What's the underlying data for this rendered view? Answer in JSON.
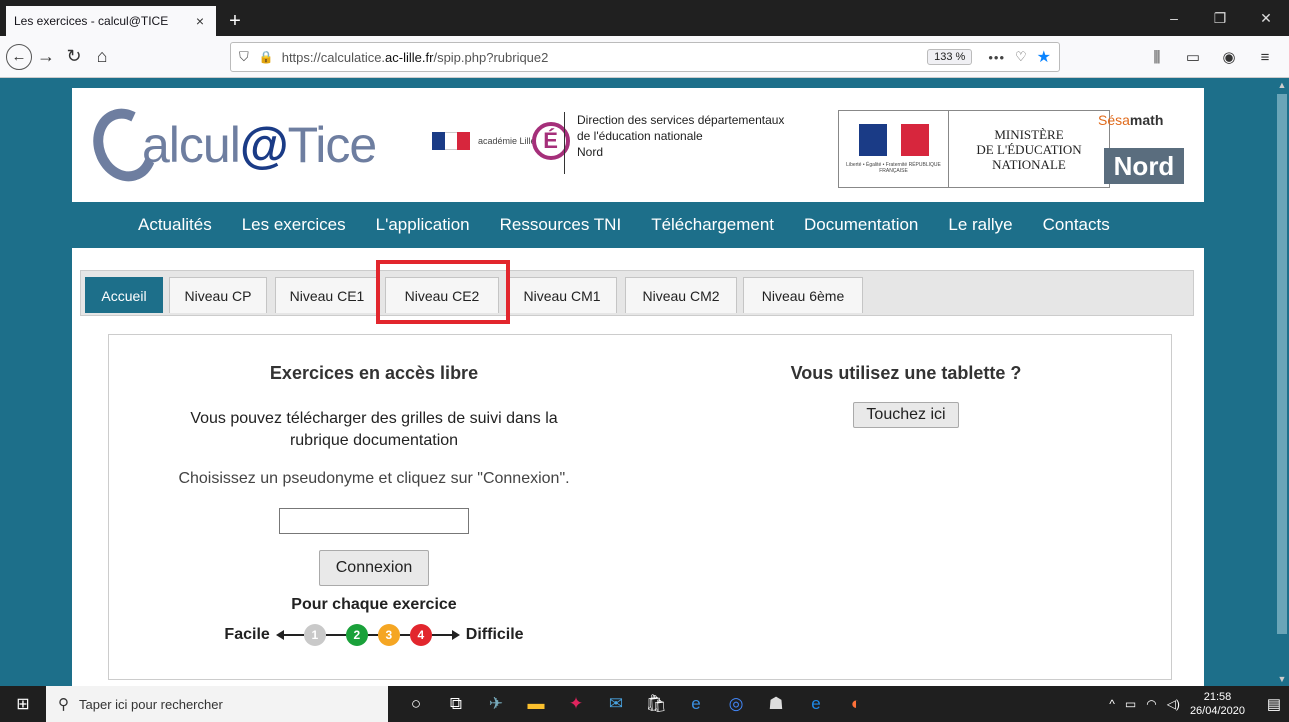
{
  "browser": {
    "tab_title": "Les exercices - calcul@TICE",
    "tab_close": "×",
    "new_tab": "+",
    "url_prefix": "https://calculatice.",
    "url_domain": "ac-lille.fr",
    "url_path": "/spip.php?rubrique2",
    "zoom": "133 %",
    "more": "•••",
    "window_min": "–",
    "window_max": "❐",
    "window_close": "✕"
  },
  "site": {
    "logo_text_1": "alcul",
    "logo_at": "@",
    "logo_text_2": "Tice",
    "academie_word": "académie Lille",
    "academie_letter": "É",
    "dsden_line1": "Direction des services départementaux",
    "dsden_line2": "de l'éducation nationale",
    "dsden_line3": "Nord",
    "ministere_motto": "Liberté • Égalité • Fraternité RÉPUBLIQUE FRANÇAISE",
    "ministere_line1": "MINISTÈRE",
    "ministere_line2": "DE L'ÉDUCATION",
    "ministere_line3": "NATIONALE",
    "sesamath_1": "Sésa",
    "sesamath_2": "math",
    "nord": "Nord"
  },
  "menu": [
    "Actualités",
    "Les exercices",
    "L'application",
    "Ressources TNI",
    "Téléchargement",
    "Documentation",
    "Le rallye",
    "Contacts"
  ],
  "tabs": [
    "Accueil",
    "Niveau CP",
    "Niveau CE1",
    "Niveau CE2",
    "Niveau CM1",
    "Niveau CM2",
    "Niveau 6ème"
  ],
  "left": {
    "heading": "Exercices en accès libre",
    "desc": "Vous pouvez télécharger des grilles de suivi dans la rubrique documentation",
    "pseudo_label": "Choisissez un pseudonyme et cliquez sur \"Connexion\".",
    "pseudo_value": "",
    "connexion": "Connexion",
    "pour": "Pour chaque exercice",
    "facile": "Facile",
    "difficile": "Difficile",
    "levels": [
      {
        "n": "1",
        "color": "#c9c9c9"
      },
      {
        "n": "2",
        "color": "#1aa13a"
      },
      {
        "n": "3",
        "color": "#f5a623"
      },
      {
        "n": "4",
        "color": "#e2262d"
      }
    ]
  },
  "right": {
    "heading": "Vous utilisez une tablette ?",
    "touch": "Touchez ici"
  },
  "taskbar": {
    "search_placeholder": "Taper ici pour rechercher",
    "time": "21:58",
    "date": "26/04/2020"
  }
}
